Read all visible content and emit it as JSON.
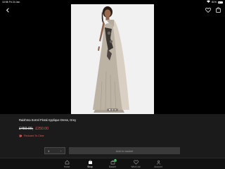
{
  "status_bar": {
    "time": "10:56",
    "date": "Fri 24 Jan",
    "battery": "81%"
  },
  "top_bar": {
    "icons": [
      "chevron-left-icon",
      "heart-icon",
      "shopping-bag-icon"
    ]
  },
  "product": {
    "image_icon": "product-photo",
    "carousel_count": 3,
    "carousel_active": 1,
    "title": "Raishma Sorrel Floral Applique Dress, Grey",
    "old_price": "£450.00,",
    "new_price": "£250.00",
    "promo_label": "Reduced To Clear"
  },
  "purchase": {
    "quantity_value": "1",
    "add_button_label": "Add to basket"
  },
  "tab_bar": {
    "tabs": [
      {
        "label": "Home",
        "icon": "home-icon"
      },
      {
        "label": "Shop",
        "icon": "shop-icon"
      },
      {
        "label": "Basket",
        "icon": "basket-icon",
        "badge": "0"
      },
      {
        "label": "Wish List",
        "icon": "heart-icon"
      },
      {
        "label": "Account",
        "icon": "account-icon"
      }
    ],
    "active": "Shop"
  },
  "colors": {
    "sale": "#e45b5b",
    "badge": "#2aa84a",
    "panel": "#1b1b1b"
  }
}
